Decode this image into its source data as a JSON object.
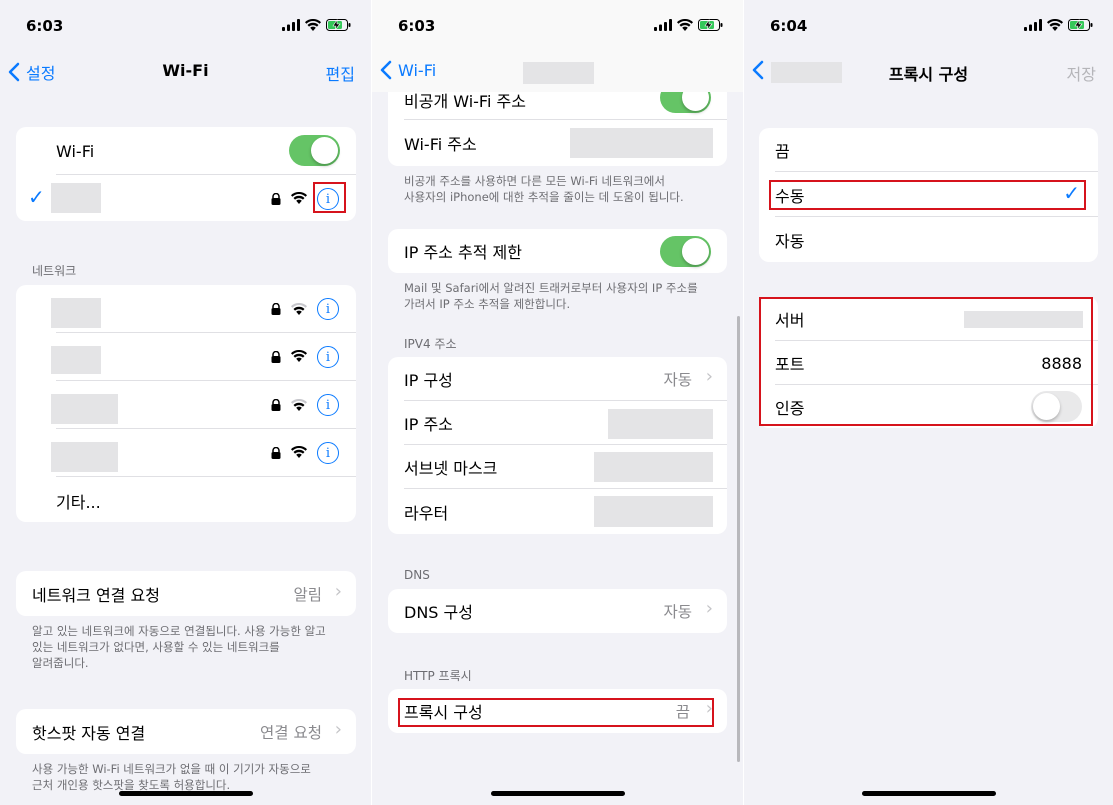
{
  "accent": "#0a7aff",
  "panel1": {
    "time": "6:03",
    "back_label": "설정",
    "title": "Wi-Fi",
    "edit_label": "편집",
    "wifi_label": "Wi-Fi",
    "networks_header": "네트워크",
    "other_label": "기타...",
    "ask_join_label": "네트워크 연결 요청",
    "ask_join_value": "알림",
    "ask_join_footer_1": "알고 있는 네트워크에 자동으로 연결됩니다. 사용 가능한 알고",
    "ask_join_footer_2": "있는 네트워크가 없다면, 사용할 수 있는 네트워크를",
    "ask_join_footer_3": "알려줍니다.",
    "hotspot_label": "핫스팟 자동 연결",
    "hotspot_value": "연결 요청",
    "hotspot_footer_1": "사용 가능한 Wi-Fi 네트워크가 없을 때 이 기기가 자동으로",
    "hotspot_footer_2": "근처 개인용 핫스팟을 찾도록 허용합니다."
  },
  "panel2": {
    "time": "6:03",
    "back_label": "Wi-Fi",
    "private_address_label": "비공개 Wi-Fi 주소",
    "wifi_address_label": "Wi-Fi 주소",
    "private_footer_1": "비공개 주소를 사용하면 다른 모든 Wi-Fi 네트워크에서",
    "private_footer_2": "사용자의 iPhone에 대한 추적을 줄이는 데 도움이 됩니다.",
    "limit_ip_label": "IP 주소 추적 제한",
    "limit_ip_footer_1": "Mail 및 Safari에서 알려진 트래커로부터 사용자의 IP 주소를",
    "limit_ip_footer_2": "가려서 IP 주소 추적을 제한합니다.",
    "ipv4_header": "IPV4 주소",
    "configure_ip_label": "IP 구성",
    "configure_ip_value": "자동",
    "ip_address_label": "IP 주소",
    "subnet_label": "서브넷 마스크",
    "router_label": "라우터",
    "dns_header": "DNS",
    "configure_dns_label": "DNS 구성",
    "configure_dns_value": "자동",
    "http_proxy_header": "HTTP 프록시",
    "configure_proxy_label": "프록시 구성",
    "configure_proxy_value": "끔"
  },
  "panel3": {
    "time": "6:04",
    "title": "프록시 구성",
    "save_label": "저장",
    "opt_off": "끔",
    "opt_manual": "수동",
    "opt_auto": "자동",
    "server_label": "서버",
    "port_label": "포트",
    "port_value": "8888",
    "auth_label": "인증"
  }
}
